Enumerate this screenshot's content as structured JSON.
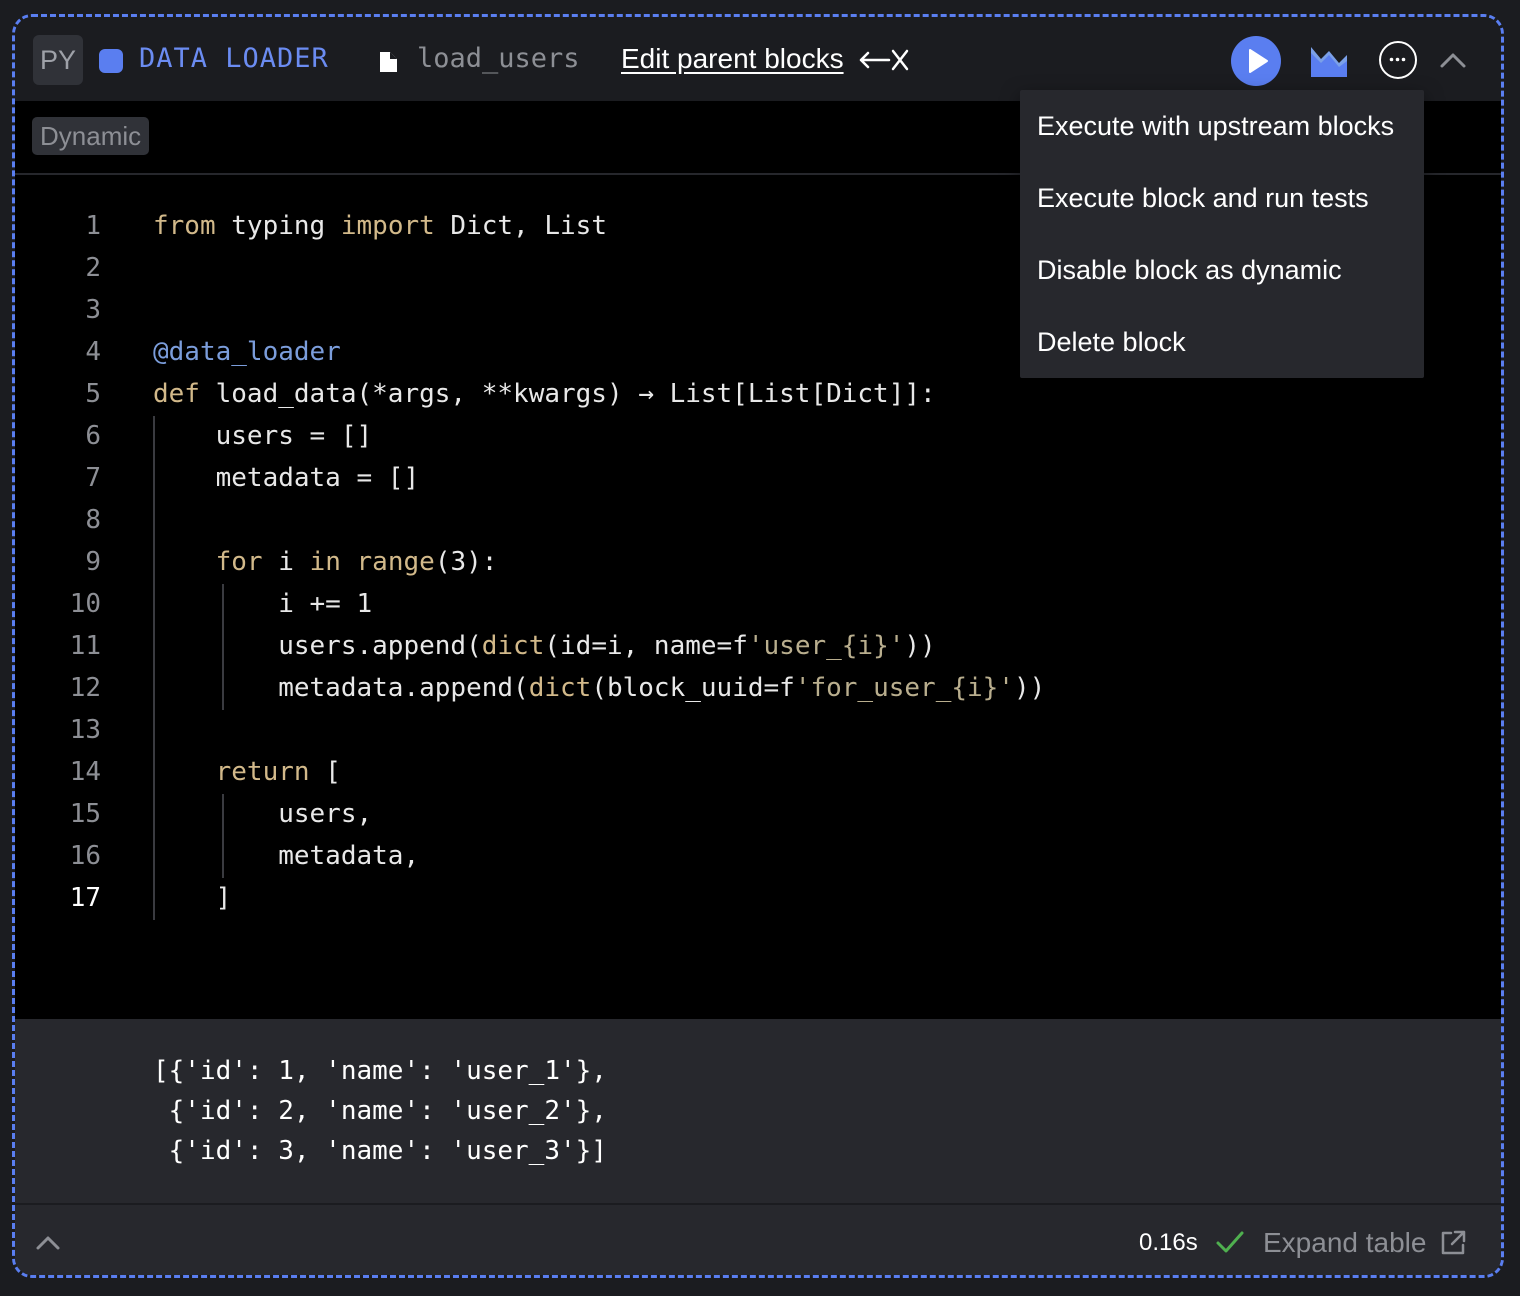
{
  "header": {
    "language": "PY",
    "block_type": "DATA LOADER",
    "file_name": "load_users",
    "edit_parents_label": "Edit parent blocks"
  },
  "tags": [
    "Dynamic"
  ],
  "colors": {
    "accent": "#5a7ef0",
    "background": "#1b1c20",
    "editor_background": "#000000",
    "output_background": "#27282d",
    "success": "#4fb04f"
  },
  "icons": [
    "file-icon",
    "arrows-icon",
    "play-icon",
    "chart-icon",
    "more-icon",
    "chevron-up-icon",
    "check-icon",
    "external-link-icon"
  ],
  "code": {
    "language": "python",
    "active_line": 17,
    "lines": [
      "from typing import Dict, List",
      "",
      "",
      "@data_loader",
      "def load_data(*args, **kwargs) → List[List[Dict]]:",
      "    users = []",
      "    metadata = []",
      "",
      "    for i in range(3):",
      "        i += 1",
      "        users.append(dict(id=i, name=f'user_{i}'))",
      "        metadata.append(dict(block_uuid=f'for_user_{i}'))",
      "",
      "    return [",
      "        users,",
      "        metadata,",
      "    ]"
    ]
  },
  "output": {
    "lines": [
      "[{'id': 1, 'name': 'user_1'},",
      " {'id': 2, 'name': 'user_2'},",
      " {'id': 3, 'name': 'user_3'}]"
    ],
    "execution_time": "0.16s",
    "expand_table_label": "Expand table"
  },
  "menu": {
    "items": [
      "Execute with upstream blocks",
      "Execute block and run tests",
      "Disable block as dynamic",
      "Delete block"
    ]
  }
}
